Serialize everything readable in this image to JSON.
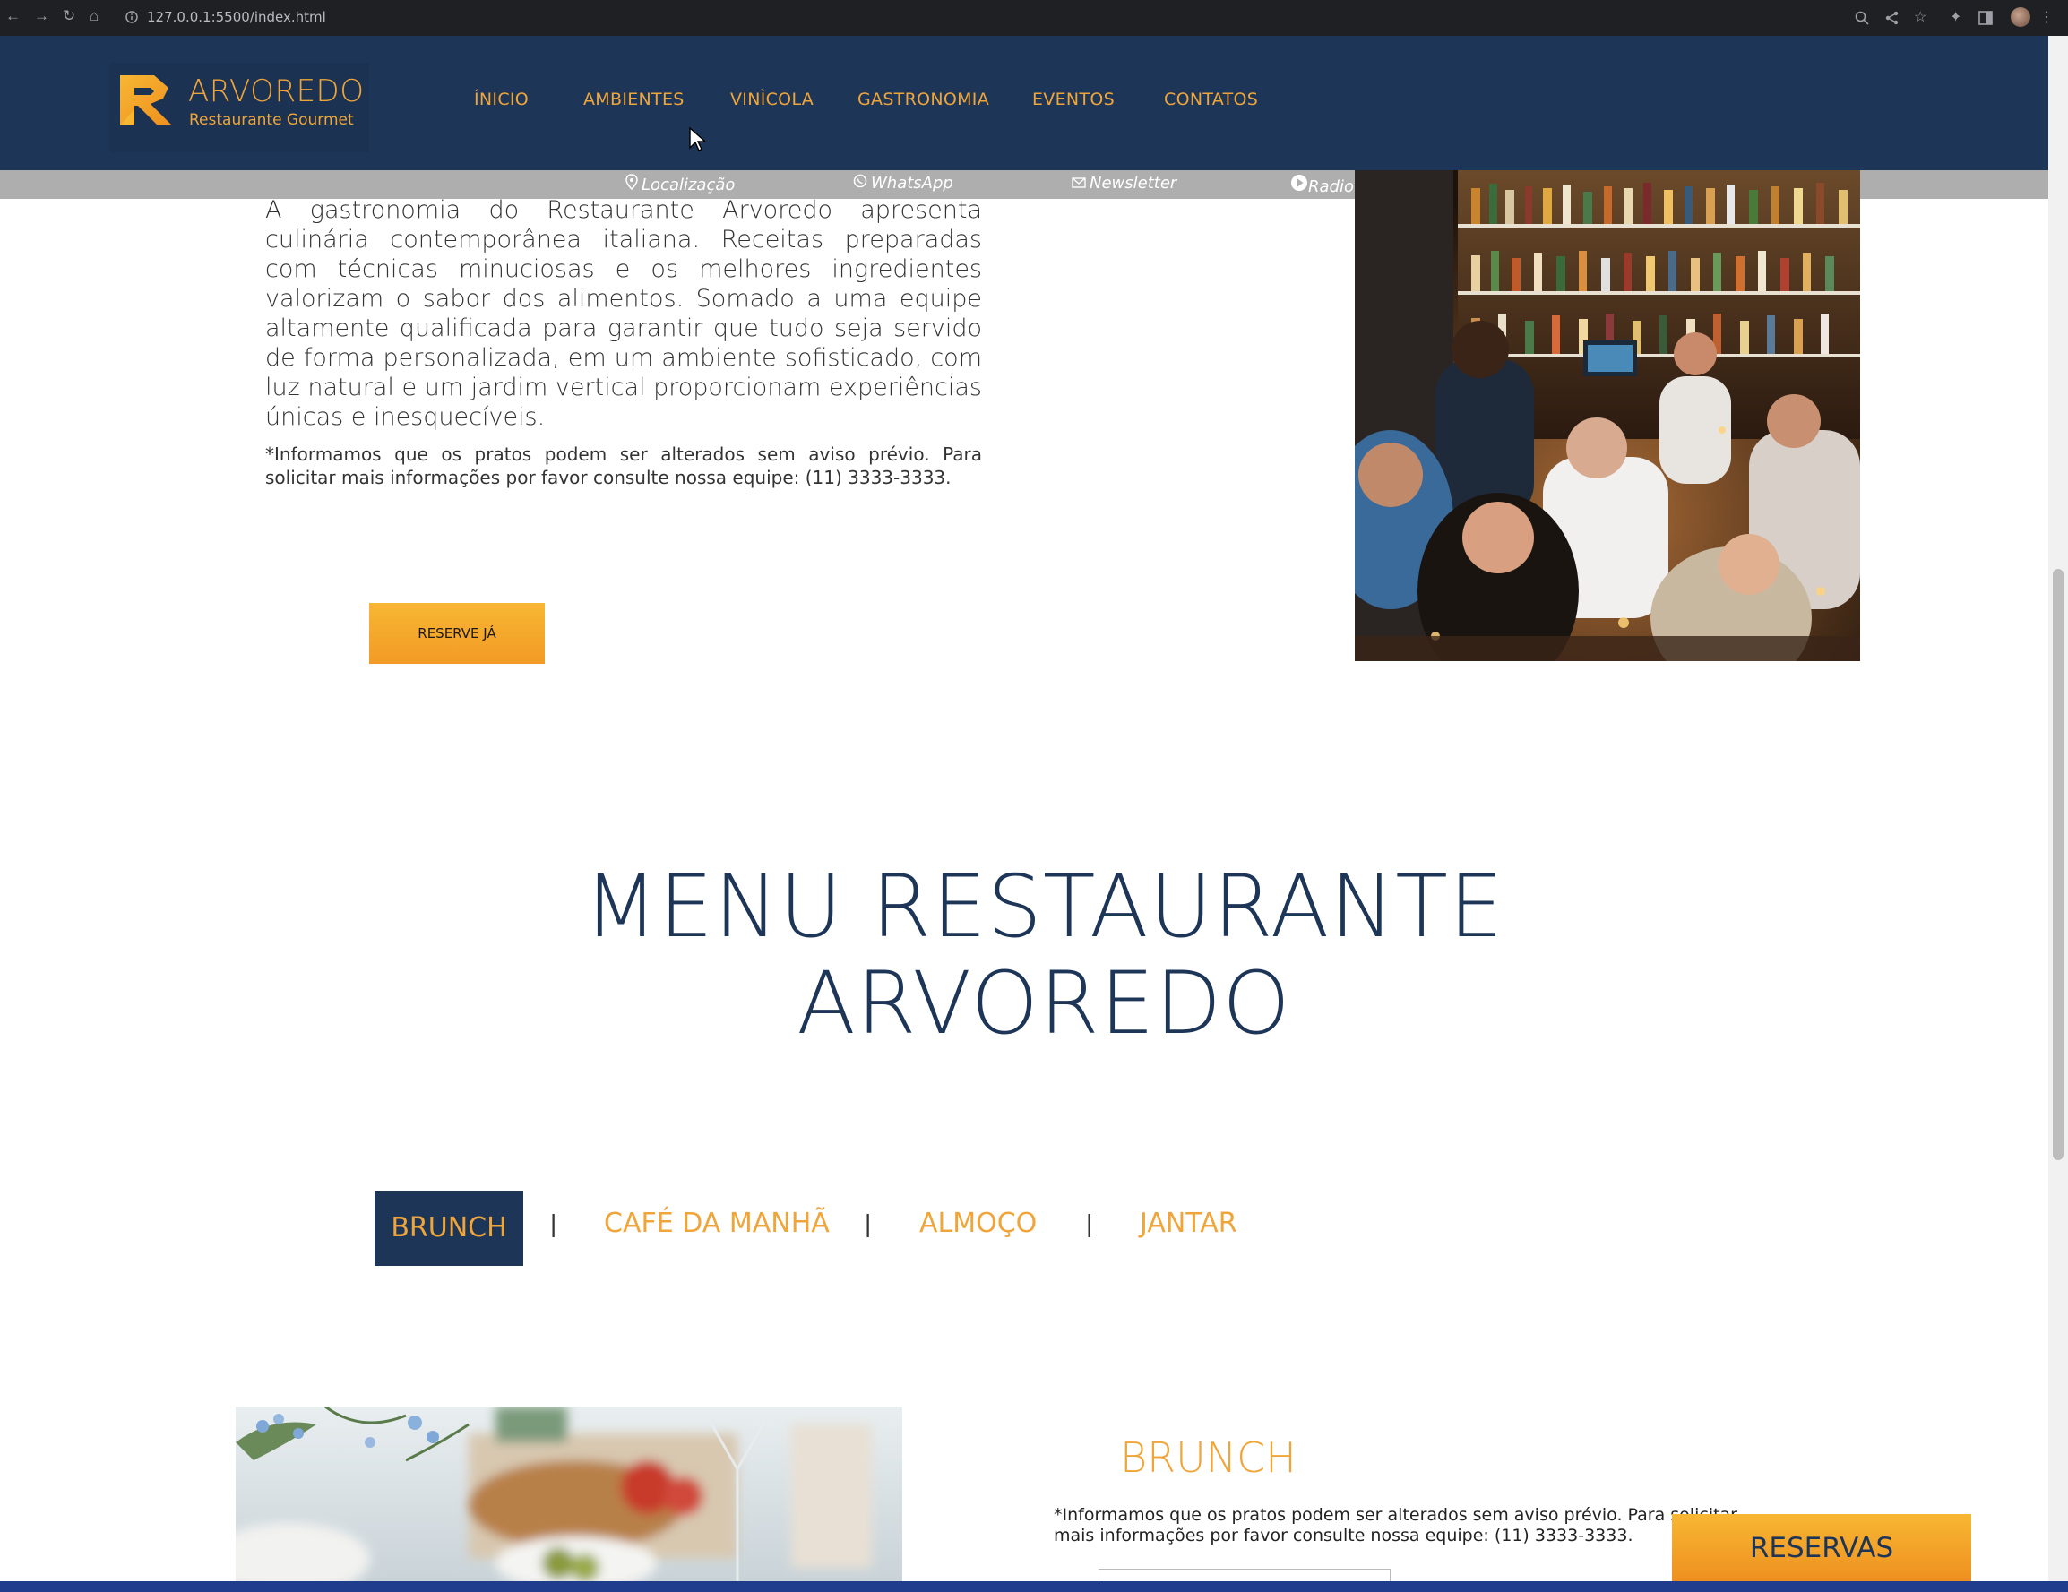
{
  "browser": {
    "url": "127.0.0.1:5500/index.html",
    "icons": [
      "back-icon",
      "forward-icon",
      "reload-icon",
      "home-icon",
      "info-icon",
      "zoom-icon",
      "share-icon",
      "star-icon",
      "extensions-icon",
      "sidepanel-icon",
      "profile-avatar",
      "menu-icon"
    ]
  },
  "header": {
    "logo_title": "ARVOREDO",
    "logo_subtitle": "Restaurante Gourmet",
    "nav": [
      "ÍNICIO",
      "AMBIENTES",
      "VINÌCOLA",
      "GASTRONOMIA",
      "EVENTOS",
      "CONTATOS"
    ]
  },
  "subbar": {
    "items": [
      {
        "label": "Localização",
        "icon": "map-pin-icon"
      },
      {
        "label": "WhatsApp",
        "icon": "whatsapp-icon"
      },
      {
        "label": "Newsletter",
        "icon": "mail-icon"
      },
      {
        "label": "Radio Arvoredo",
        "icon": "play-circle-icon"
      }
    ]
  },
  "intro": {
    "text": "A gastronomia do Restaurante Arvoredo apresenta culinária contemporânea italiana. Receitas preparadas com técnicas minuciosas e os melhores ingredientes valorizam o sabor dos alimentos. Somado a uma equipe altamente qualificada para garantir que tudo seja servido de forma personalizada, em um ambiente sofisticado, com luz natural e um jardim vertical proporcionam experiências únicas e inesquecíveis.",
    "note": "*Informamos que os pratos podem ser alterados sem aviso prévio. Para solicitar mais informações por favor consulte nossa equipe: (11) 3333-3333.",
    "reserve_label": "RESERVE JÁ"
  },
  "menu_section": {
    "title_line1": "MENU RESTAURANTE",
    "title_line2": "ARVOREDO",
    "tabs": [
      "BRUNCH",
      "CAFÉ DA MANHÃ",
      "ALMOÇO",
      "JANTAR"
    ],
    "separator": "|",
    "active_tab": "BRUNCH"
  },
  "brunch": {
    "heading": "BRUNCH",
    "note": "*Informamos que os pratos podem ser alterados sem aviso prévio. Para solicitar mais informações por favor consulte nossa equipe: (11) 3333-3333."
  },
  "floating": {
    "reservas_label": "RESERVAS"
  },
  "colors": {
    "navy": "#1d3557",
    "accent": "#f0a53a",
    "gradient_start": "#f7b733",
    "gradient_end": "#ee8f1f"
  }
}
